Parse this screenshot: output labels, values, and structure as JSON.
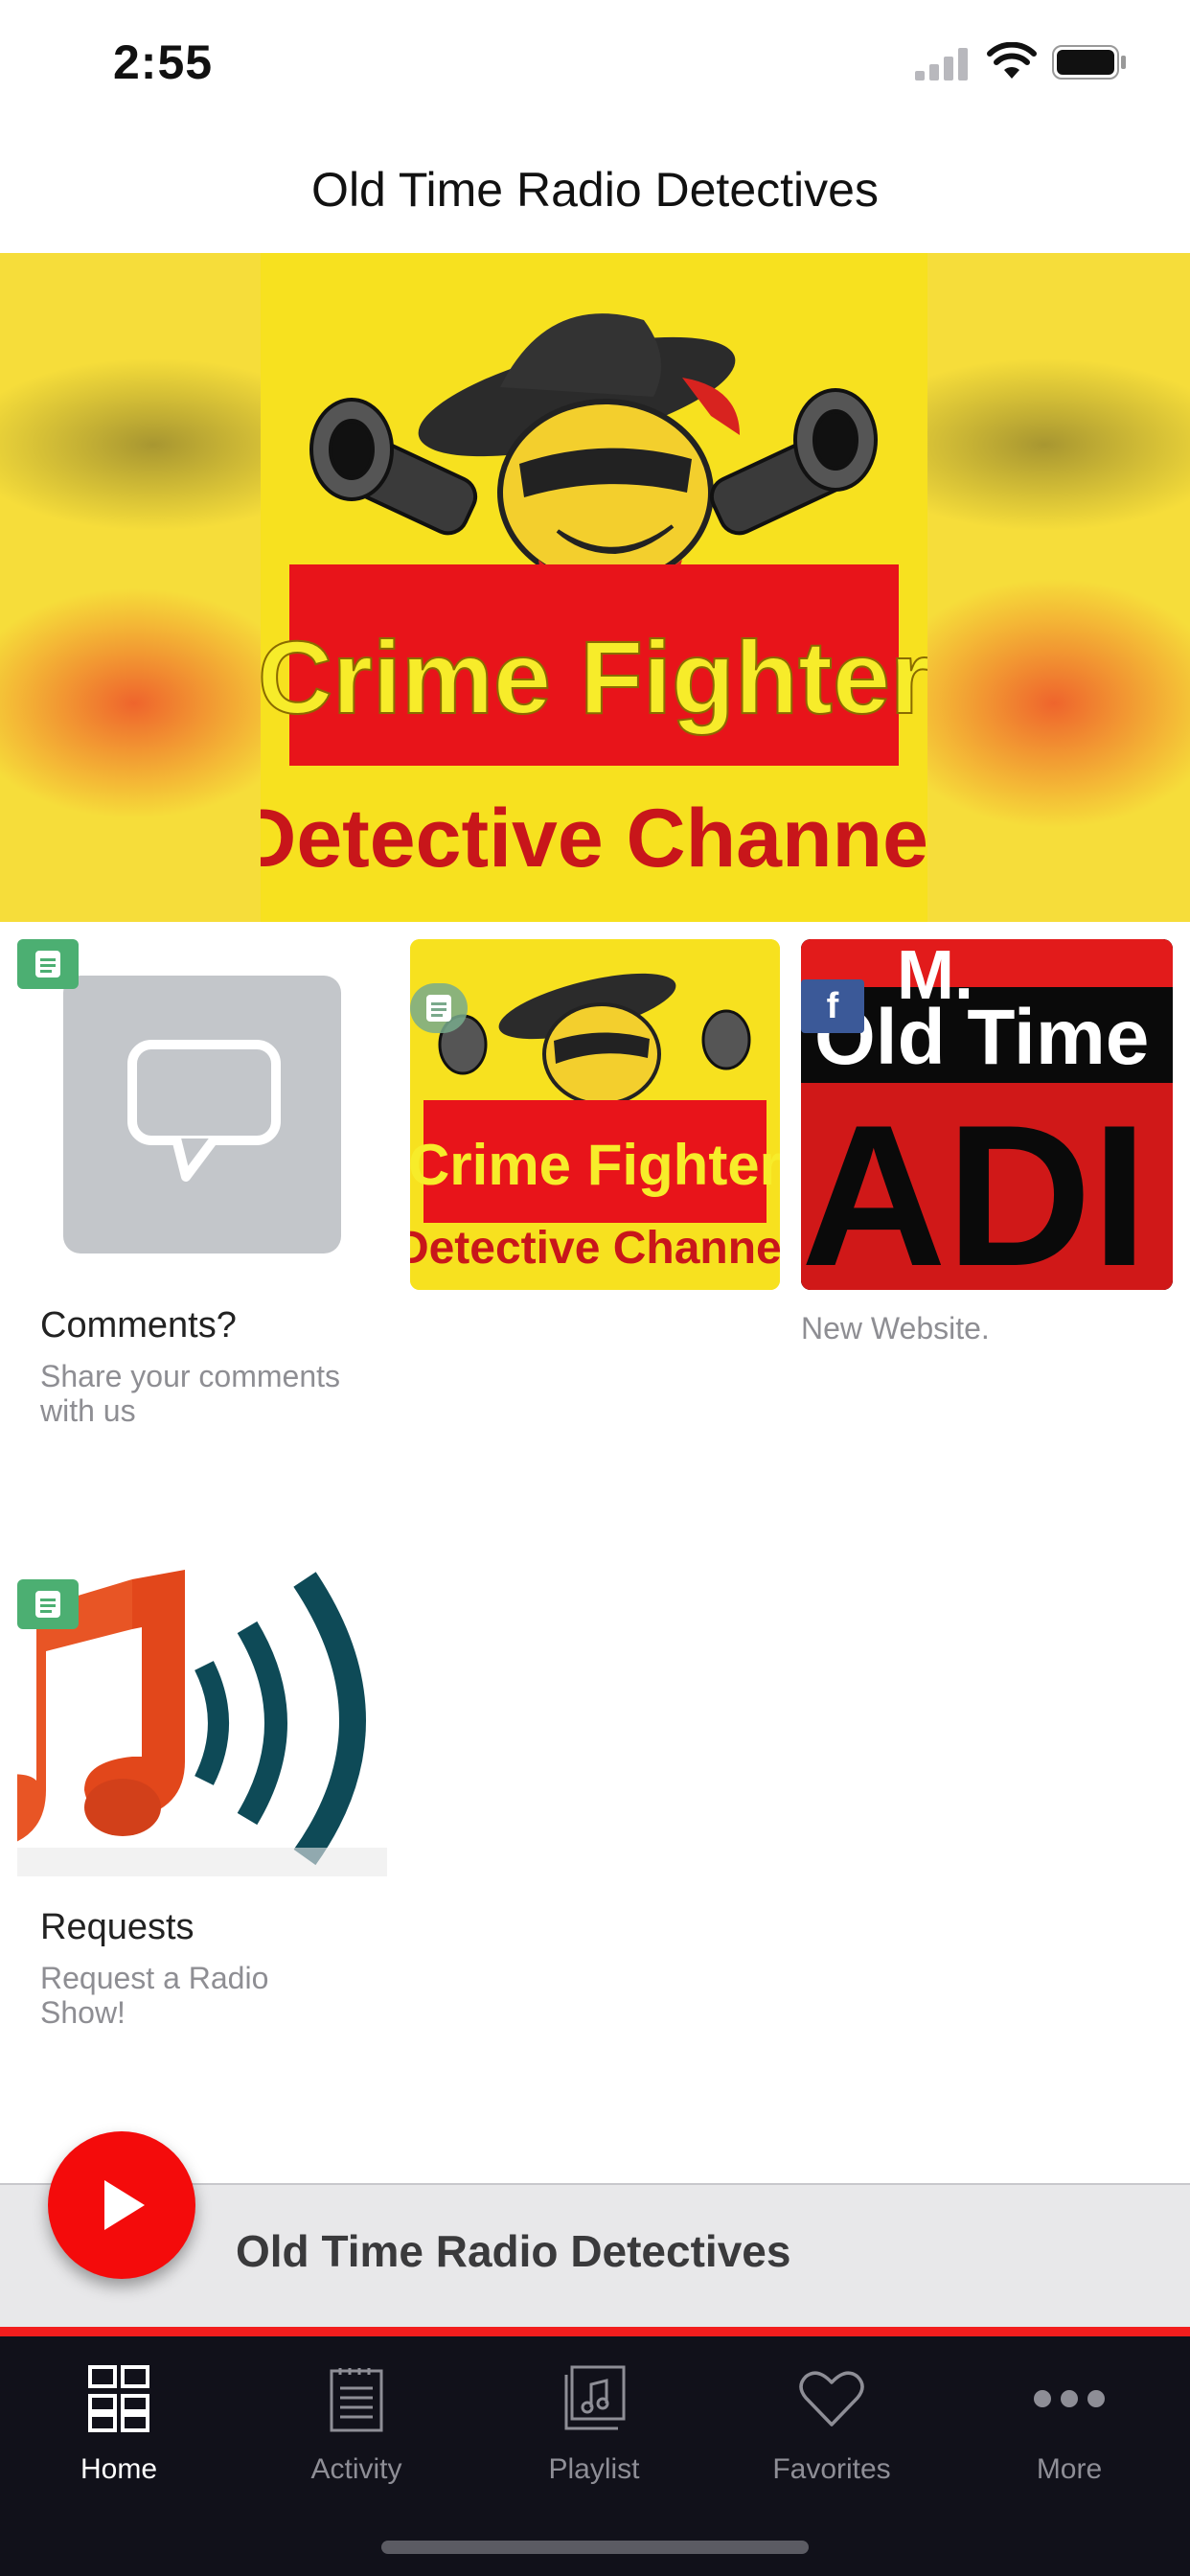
{
  "status_bar": {
    "time": "2:55"
  },
  "header": {
    "title": "Old Time Radio Detectives"
  },
  "hero": {
    "image_label": "Crime Fighter Detective Channel banner",
    "text_line1": "Crime Fighter",
    "text_line2": "Detective Channel"
  },
  "tiles": [
    {
      "title": "Comments?",
      "subtitle": "Share your comments with us",
      "badge": "document-icon"
    },
    {
      "title": "",
      "subtitle": "",
      "badge": "document-icon",
      "image_text_line1": "Crime Fighter",
      "image_text_line2": "Detective Channel"
    },
    {
      "title": "",
      "subtitle": "New Website.",
      "badge": "facebook-icon",
      "image_text_line1": "M.",
      "image_text_line2": "Old Time",
      "image_text_line3": "ADI"
    },
    {
      "title": "Requests",
      "subtitle": "Request a Radio Show!",
      "badge": "document-icon"
    }
  ],
  "now_playing": {
    "title": "Old Time Radio Detectives"
  },
  "tab_bar": {
    "tabs": [
      {
        "label": "Home",
        "icon": "home-grid-icon",
        "active": true
      },
      {
        "label": "Activity",
        "icon": "activity-icon",
        "active": false
      },
      {
        "label": "Playlist",
        "icon": "playlist-icon",
        "active": false
      },
      {
        "label": "Favorites",
        "icon": "heart-icon",
        "active": false
      },
      {
        "label": "More",
        "icon": "more-icon",
        "active": false
      }
    ]
  },
  "colors": {
    "accent": "#f40b0b",
    "tab_bar_bg": "#11111a",
    "badge_green": "#4caf72",
    "badge_facebook": "#3b5998"
  }
}
